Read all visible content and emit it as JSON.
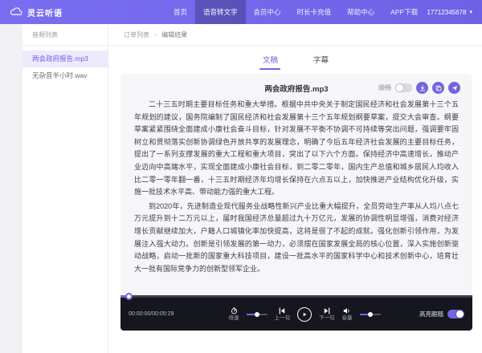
{
  "navbar": {
    "brand": "灵云听语",
    "items": [
      {
        "label": "首页",
        "active": false
      },
      {
        "label": "语音转文字",
        "active": true
      },
      {
        "label": "会员中心",
        "active": false
      },
      {
        "label": "时长卡充值",
        "active": false
      },
      {
        "label": "帮助中心",
        "active": false
      },
      {
        "label": "APP下载",
        "active": false
      }
    ],
    "account": "17712345678"
  },
  "sidebar": {
    "title": "音频列表",
    "items": [
      {
        "label": "两会政府报告.mp3",
        "active": true
      },
      {
        "label": "无杂音半小时.wav",
        "active": false
      }
    ]
  },
  "main": {
    "breadcrumb_left": "订单列表",
    "breadcrumb_sep": "›",
    "breadcrumb_current": "编辑结果",
    "tabs": [
      {
        "label": "文稿",
        "active": true
      },
      {
        "label": "字幕",
        "active": false
      }
    ],
    "card": {
      "title": "两会政府报告.mp3",
      "smooth_label": "顺畅",
      "smooth_on": false,
      "paragraphs": {
        "0": "二十三五时期主要目标任务和重大举措。根据中共中央关于制定国民经济和社会发展第十三个五年规划的建议，国务院编制了国民经济和社会发展第十三个五年规划纲要草案，提交大会审查。纲要草案紧紧围绕全面建成小康社会奋斗目标，针对发展不平衡不协调不可持续等突出问题，强调要牢固树立和贯彻落实创新协调绿色开放共享的发展理念，明确了今后五年经济社会发展的主要目标任务，提出了一系列支撑发展的重大工程和重大项目，突出了以下六个方面。保持经济中高速增长，推动产业迈向中高端水平，实现全面建成小康社会目标，到二零二零年，国内生产总值和城乡居民人均收入比二零一零年翻一番，十三五时期经济年均增长保持在六点五以上，加快推进产业结构优化升级，实施一批技术水平高、带动能力强的重大工程。",
        "1": "到2020年，先进制造业现代服务业战略性新兴产业比重大幅提升，全员劳动生产率从人均八点七万元提升到十二万元以上，届时我国经济总量超过九十万亿元，发展的协调性明显增强，消费对经济增长贡献继续加大，户籍人口城镇化率加快提高，这将是很了不起的成就。强化创新引领作用，为发展注入强大动力。创新是引领发展的第一动力，必须摆在国家发展全局的核心位置，深入实施创新驱动战略，启动一批新的国家重大科技项目，建设一批高水平的国家科学中心和技术创新中心，培育壮大一批有国际竞争力的创新型领军企业。"
      }
    },
    "player": {
      "time": "00:00:00/00:05:29",
      "speed_label": "倍速",
      "prev_label": "上一句",
      "next_label": "下一句",
      "volume_label": "音量",
      "highlight_label": "高亮跟随",
      "highlight_on": true
    }
  },
  "icons": {
    "logo": "cloud-icon",
    "account_caret": "chevron-down-icon",
    "card_buttons": [
      "download-icon",
      "copy-icon",
      "share-icon"
    ],
    "player": [
      "speed-icon",
      "prev-sentence-icon",
      "play-icon",
      "next-sentence-icon",
      "volume-icon"
    ]
  },
  "colors": {
    "primary": "#7066e0",
    "nav_bg": "#6f61e6",
    "card_bg": "#f6f6f9",
    "player_bg": "#16161e",
    "sidebar_active_bg": "#edeafc"
  }
}
